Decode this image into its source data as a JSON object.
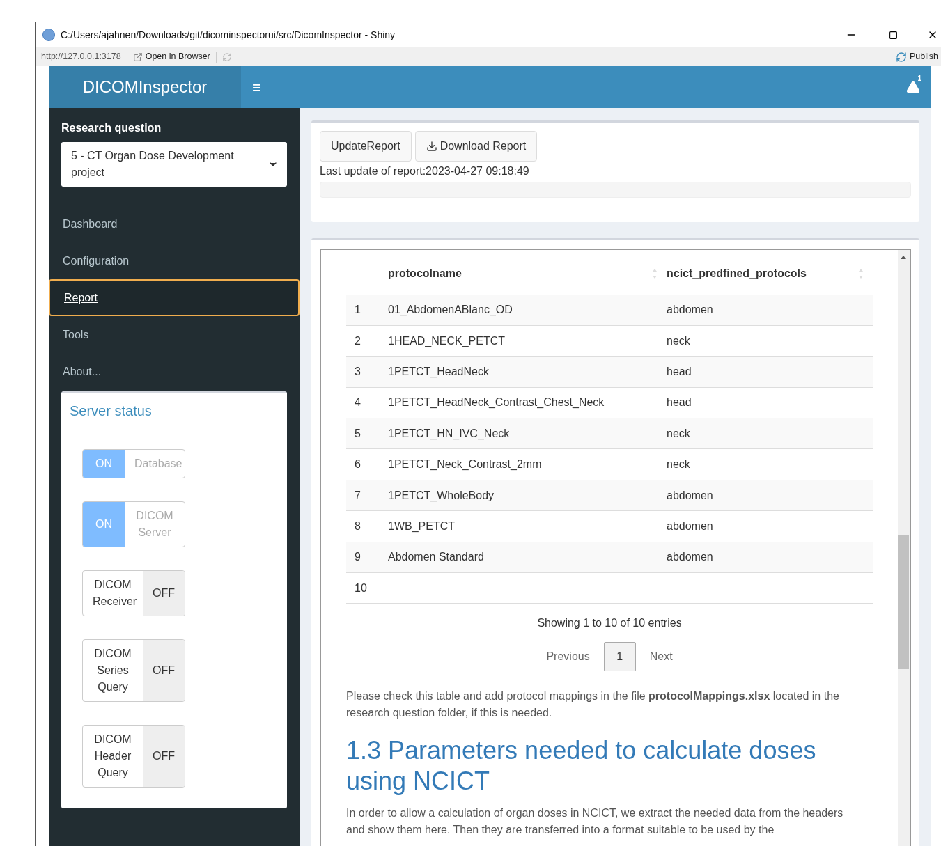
{
  "window": {
    "title": "C:/Users/ajahnen/Downloads/git/dicominspectorui/src/DicomInspector - Shiny"
  },
  "toolbar": {
    "url": "http://127.0.0.1:3178",
    "open_in_browser": "Open in Browser",
    "publish": "Publish"
  },
  "header": {
    "logo": "DICOMInspector",
    "menu_toggle": "≡",
    "notification_count": "1"
  },
  "sidebar": {
    "research_question_label": "Research question",
    "research_question_value": "5 - CT Organ Dose Development project",
    "items": [
      {
        "label": "Dashboard",
        "selected": false
      },
      {
        "label": "Configuration",
        "selected": false
      },
      {
        "label": "Report",
        "selected": true
      },
      {
        "label": "Tools",
        "selected": false
      },
      {
        "label": "About...",
        "selected": false
      }
    ],
    "server_status": {
      "title": "Server status",
      "switches": [
        {
          "label": "Database",
          "on": true,
          "state_text": "ON"
        },
        {
          "label": "DICOM Server",
          "on": true,
          "state_text": "ON"
        },
        {
          "label": "DICOM Receiver",
          "on": false,
          "state_text": "OFF"
        },
        {
          "label": "DICOM Series Query",
          "on": false,
          "state_text": "OFF"
        },
        {
          "label": "DICOM Header Query",
          "on": false,
          "state_text": "OFF"
        }
      ]
    }
  },
  "report_controls": {
    "buttons": [
      "UpdateReport",
      "Download Report"
    ],
    "last_update": "Last update of report:2023-04-27 09:18:49"
  },
  "report": {
    "table": {
      "columns": [
        "protocolname",
        "ncict_predfined_protocols"
      ],
      "rows": [
        {
          "index": "1",
          "protocolname": "01_AbdomenABlanc_OD",
          "protocol": "abdomen"
        },
        {
          "index": "2",
          "protocolname": "1HEAD_NECK_PETCT",
          "protocol": "neck"
        },
        {
          "index": "3",
          "protocolname": "1PETCT_HeadNeck",
          "protocol": "head"
        },
        {
          "index": "4",
          "protocolname": "1PETCT_HeadNeck_Contrast_Chest_Neck",
          "protocol": "head"
        },
        {
          "index": "5",
          "protocolname": "1PETCT_HN_IVC_Neck",
          "protocol": "neck"
        },
        {
          "index": "6",
          "protocolname": "1PETCT_Neck_Contrast_2mm",
          "protocol": "neck"
        },
        {
          "index": "7",
          "protocolname": "1PETCT_WholeBody",
          "protocol": "abdomen"
        },
        {
          "index": "8",
          "protocolname": "1WB_PETCT",
          "protocol": "abdomen"
        },
        {
          "index": "9",
          "protocolname": "Abdomen Standard",
          "protocol": "abdomen"
        },
        {
          "index": "10"
        }
      ],
      "info": "Showing 1 to 10 of 10 entries",
      "pagination": [
        {
          "label": "Previous",
          "selected": false
        },
        {
          "label": "1",
          "selected": true
        },
        {
          "label": "Next",
          "selected": false
        }
      ]
    },
    "note": "Please check this table and add protocol mappings in the file **protocolMappings.xlsx** located in the research question folder, if this is needed.",
    "heading": "1.3 Parameters needed to calculate doses using NCICT",
    "paragraph": "In order to allow a calculation of organ doses in NCICT, we extract the needed data from the headers and show them here. Then they are transferred into a format suitable to be used by the"
  }
}
